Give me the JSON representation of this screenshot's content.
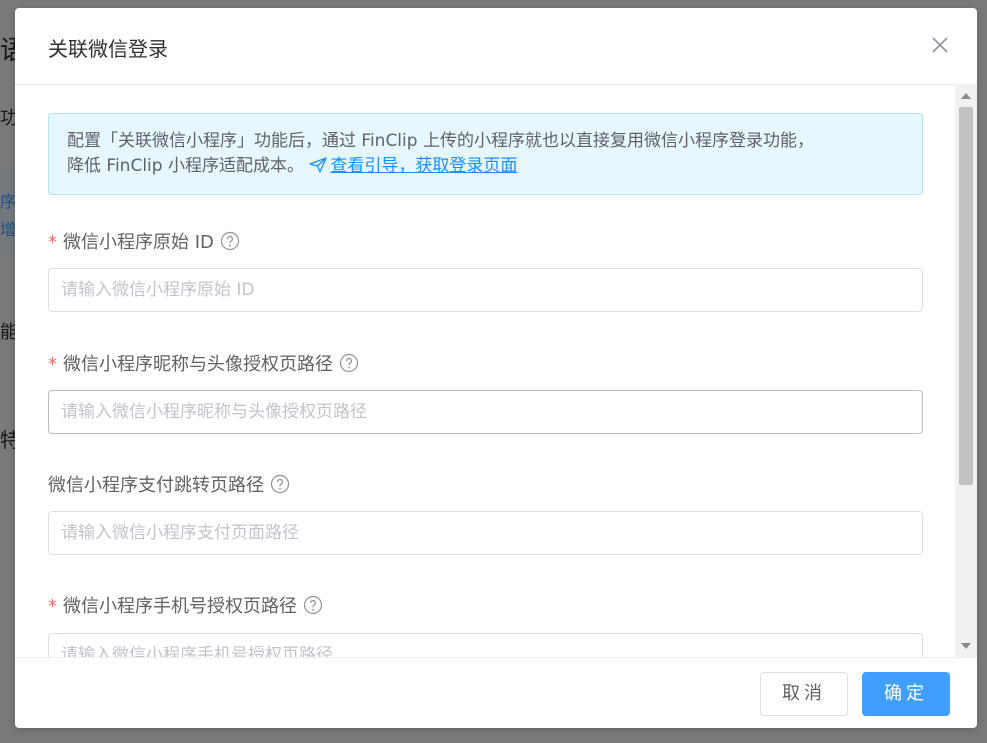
{
  "background": {
    "fragments": [
      "语",
      "功能",
      "序",
      "增强",
      "能全",
      "特"
    ]
  },
  "dialog": {
    "title": "关联微信登录",
    "close_icon": "close-icon",
    "notice": {
      "text_line1": "配置「关联微信小程序」功能后，通过 FinClip 上传的小程序就也以直接复用微信小程序登录功能，",
      "text_line2": "降低 FinClip 小程序适配成本。",
      "link_icon": "send-icon",
      "link_text": "查看引导，获取登录页面"
    },
    "fields": [
      {
        "label": "微信小程序原始 ID",
        "required": "*",
        "placeholder": "请输入微信小程序原始 ID",
        "value": ""
      },
      {
        "label": "微信小程序昵称与头像授权页路径",
        "required": "*",
        "placeholder": "请输入微信小程序昵称与头像授权页路径",
        "value": ""
      },
      {
        "label": "微信小程序支付跳转页路径",
        "required": "",
        "placeholder": "请输入微信小程序支付页面路径",
        "value": ""
      },
      {
        "label": "微信小程序手机号授权页路径",
        "required": "*",
        "placeholder": "请输入微信小程序手机号授权页路径",
        "value": ""
      }
    ],
    "footer": {
      "cancel_label": "取消",
      "confirm_label": "确定"
    }
  },
  "colors": {
    "primary": "#409eff",
    "required": "#f56c6c",
    "notice_bg": "#e6f7ff",
    "link": "#1890ff"
  }
}
